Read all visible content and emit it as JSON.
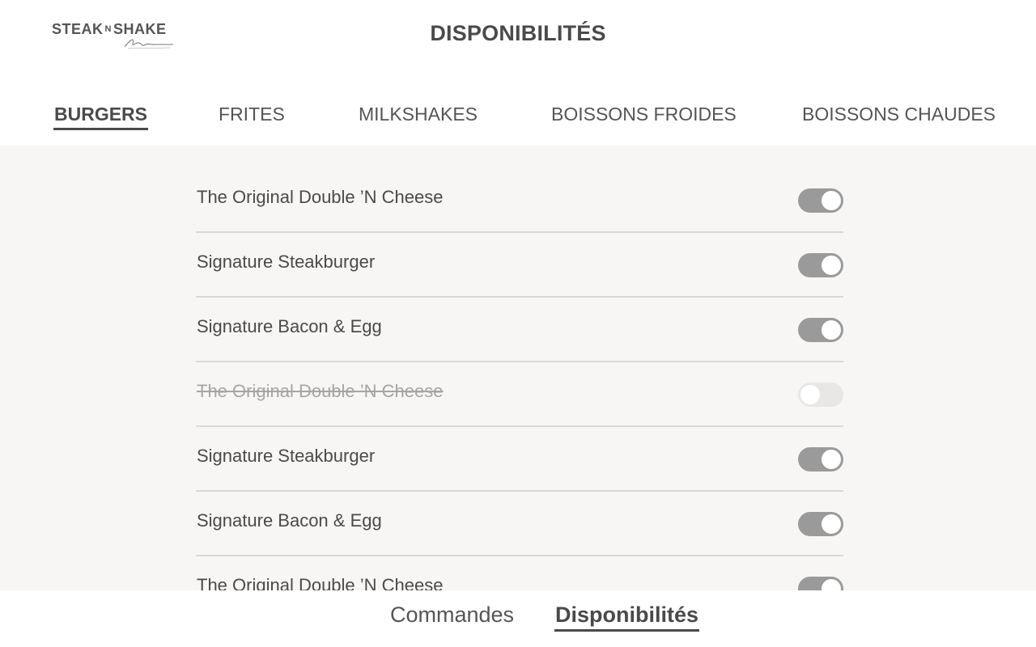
{
  "header": {
    "logo_text_left": "STEAK",
    "logo_text_mid": "N",
    "logo_text_right": "SHAKE",
    "title": "DISPONIBILITÉS"
  },
  "tabs": [
    {
      "label": "BURGERS",
      "active": true
    },
    {
      "label": "FRITES",
      "active": false
    },
    {
      "label": "MILKSHAKES",
      "active": false
    },
    {
      "label": "BOISSONS FROIDES",
      "active": false
    },
    {
      "label": "BOISSONS CHAUDES",
      "active": false
    }
  ],
  "items": [
    {
      "label": "The Original Double ’N Cheese",
      "available": true
    },
    {
      "label": "Signature Steakburger",
      "available": true
    },
    {
      "label": "Signature Bacon & Egg",
      "available": true
    },
    {
      "label": "The Original Double ’N Cheese",
      "available": false
    },
    {
      "label": "Signature Steakburger",
      "available": true
    },
    {
      "label": "Signature Bacon & Egg",
      "available": true
    },
    {
      "label": "The Original Double ’N Cheese",
      "available": true
    }
  ],
  "bottom_nav": [
    {
      "label": "Commandes",
      "active": false
    },
    {
      "label": "Disponibilités",
      "active": true
    }
  ],
  "colors": {
    "toggle_on": "#9a9a9a",
    "toggle_off": "#e8e7e5",
    "list_background": "#f7f6f4",
    "text": "#4a4a4a"
  }
}
